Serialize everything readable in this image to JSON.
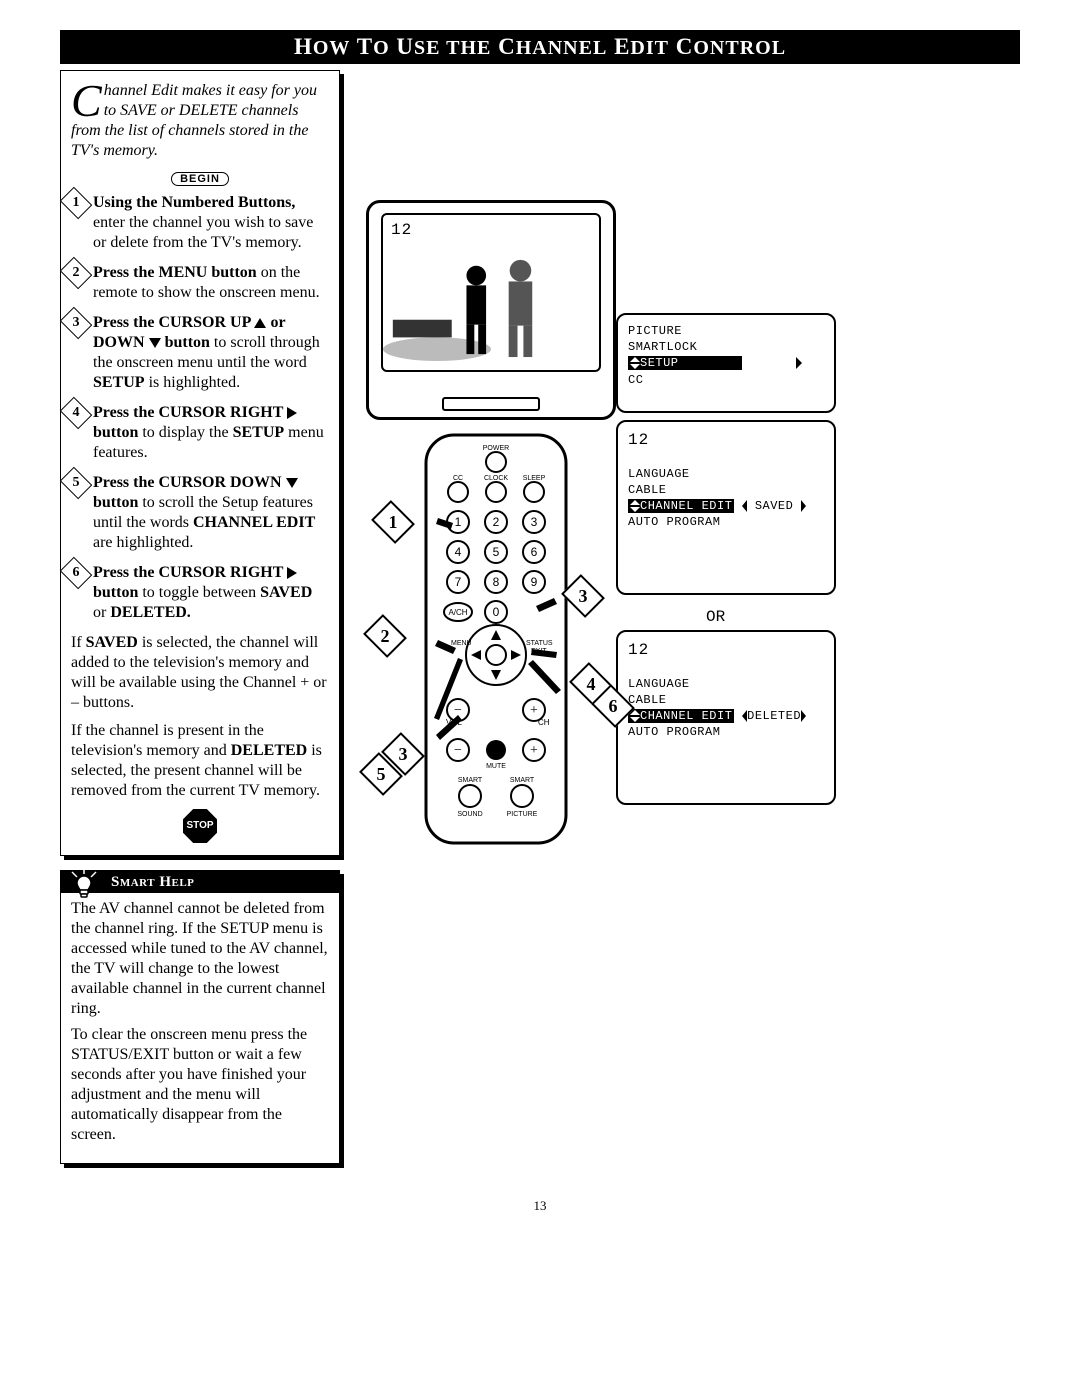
{
  "title_html": "H<span class='cap'>OW</span> T<span class='cap'>O</span> U<span class='cap'>SE</span> <span class='cap'>THE</span> C<span class='cap'>HANNEL</span> E<span class='cap'>DIT</span> C<span class='cap'>ONTROL</span>",
  "title_plain": "How To Use the Channel Edit Control",
  "intro": {
    "dropcap": "C",
    "rest": "hannel Edit makes it easy for you to SAVE or DELETE channels from the list of channels stored in the TV's memory."
  },
  "begin_label": "BEGIN",
  "steps": [
    {
      "n": "1",
      "bold": "Using the Numbered Buttons,",
      "rest": " enter the channel you wish to save or delete from the TV's memory."
    },
    {
      "n": "2",
      "bold": "Press the MENU button",
      "rest": " on the remote to show the onscreen menu."
    },
    {
      "n": "3",
      "bold": "Press the CURSOR UP ▲ or DOWN ▼ button",
      "rest": " to scroll through the onscreen menu until the word ",
      "bold2": "SETUP",
      "rest2": " is highlighted."
    },
    {
      "n": "4",
      "bold": "Press the CURSOR RIGHT ▶ button",
      "rest": " to display the ",
      "bold2": "SETUP",
      "rest2": " menu features."
    },
    {
      "n": "5",
      "bold": "Press the CURSOR DOWN ▼ button",
      "rest": " to scroll the Setup features until the words ",
      "bold2": "CHANNEL EDIT",
      "rest2": " are highlighted."
    },
    {
      "n": "6",
      "bold": "Press the CURSOR RIGHT ▶ button",
      "rest": " to toggle between ",
      "bold2": "SAVED",
      "rest2": " or ",
      "bold3": "DELETED.",
      "rest3": ""
    }
  ],
  "saved_para": {
    "pre": "If ",
    "b1": "SAVED",
    "mid": " is selected, the channel will added to the television's memory and will be available using the Channel + or – buttons."
  },
  "deleted_para": {
    "pre": "If the channel is present in the television's memory and ",
    "b1": "DELETED",
    "mid": " is selected, the present channel will be removed from the current TV memory."
  },
  "stop_label": "STOP",
  "smart_help": {
    "title": "Smart Help",
    "p1": "The AV channel cannot be deleted from the channel ring. If the SETUP menu is accessed while tuned to the AV channel, the TV will change to the lowest available channel in the current channel ring.",
    "p2": "To clear the onscreen menu press the STATUS/EXIT button or wait a few seconds after you have finished your adjustment and the menu will automatically disappear from the screen."
  },
  "tv1": {
    "channel": "12",
    "menu": {
      "items": [
        "PICTURE",
        "SMARTLOCK",
        "SETUP",
        "CC"
      ],
      "highlighted": "SETUP"
    }
  },
  "tv2": {
    "channel": "12",
    "menu": {
      "items": [
        "LANGUAGE",
        "CABLE",
        "CHANNEL EDIT",
        "AUTO PROGRAM"
      ],
      "highlighted": "CHANNEL EDIT",
      "value": "SAVED"
    }
  },
  "or_label": "OR",
  "tv3": {
    "channel": "12",
    "menu": {
      "items": [
        "LANGUAGE",
        "CABLE",
        "CHANNEL EDIT",
        "AUTO PROGRAM"
      ],
      "highlighted": "CHANNEL EDIT",
      "value": "DELETED"
    }
  },
  "remote": {
    "labels": {
      "power": "POWER",
      "cc": "CC",
      "clock": "CLOCK",
      "sleep": "SLEEP",
      "ach": "A/CH",
      "menu": "MENU",
      "exit": "EXIT",
      "status": "STATUS",
      "vol": "VOL",
      "ch": "CH",
      "mute": "MUTE",
      "smart_sound": "SMART SOUND",
      "smart_picture": "SMART PICTURE"
    },
    "numbers": [
      "1",
      "2",
      "3",
      "4",
      "5",
      "6",
      "7",
      "8",
      "9",
      "0"
    ],
    "markers": [
      "1",
      "2",
      "3",
      "3",
      "4",
      "5",
      "6"
    ]
  },
  "page_number": "13"
}
